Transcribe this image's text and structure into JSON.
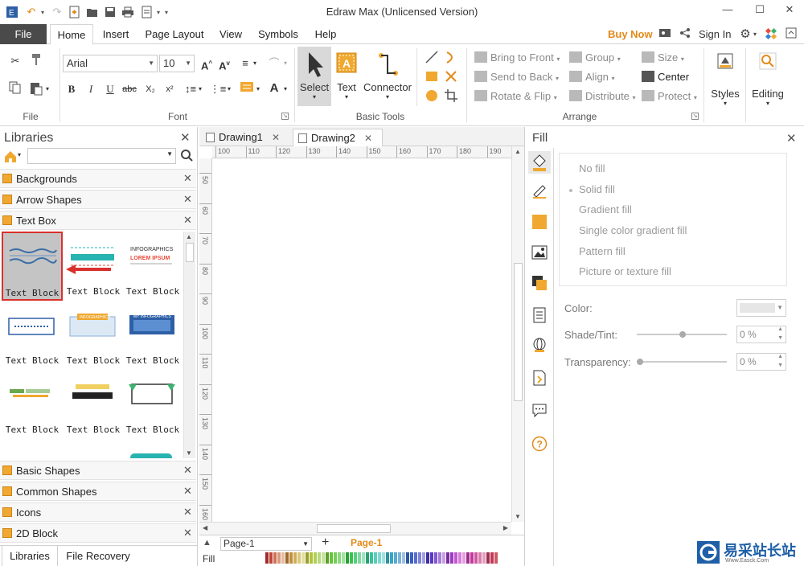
{
  "window": {
    "title": "Edraw Max (Unlicensed Version)"
  },
  "menu": {
    "file": "File",
    "tabs": [
      "Home",
      "Insert",
      "Page Layout",
      "View",
      "Symbols",
      "Help"
    ],
    "buy_now": "Buy Now",
    "sign_in": "Sign In"
  },
  "ribbon": {
    "groups": {
      "file": "File",
      "font": "Font",
      "basic_tools": "Basic Tools",
      "arrange": "Arrange"
    },
    "font": {
      "family": "Arial",
      "size": "10"
    },
    "tools": {
      "select": "Select",
      "text": "Text",
      "connector": "Connector"
    },
    "arrange": {
      "bring_to_front": "Bring to Front",
      "send_to_back": "Send to Back",
      "rotate_flip": "Rotate & Flip",
      "group": "Group",
      "align": "Align",
      "distribute": "Distribute",
      "size": "Size",
      "center": "Center",
      "protect": "Protect"
    },
    "styles": "Styles",
    "editing": "Editing",
    "format_buttons": {
      "bold": "B",
      "italic": "I",
      "underline": "U",
      "strike": "abc",
      "subscript": "X₂",
      "superscript": "x²"
    }
  },
  "libraries": {
    "title": "Libraries",
    "search_placeholder": "",
    "categories_top": [
      "Backgrounds",
      "Arrow Shapes",
      "Text Box"
    ],
    "shape_label": "Text Block",
    "shape_count": 9,
    "thumb_text": {
      "infographics": "INFOGRAPHICS",
      "lorem": "LOREM IPSUM",
      "my_info": "MY INFOGRAPHICS"
    },
    "categories_bottom": [
      "Basic Shapes",
      "Common Shapes",
      "Icons",
      "2D Block"
    ],
    "tabs": [
      "Libraries",
      "File Recovery"
    ]
  },
  "documents": {
    "tabs": [
      "Drawing1",
      "Drawing2"
    ]
  },
  "rulers": {
    "horizontal": [
      "100",
      "110",
      "120",
      "130",
      "140",
      "150",
      "160",
      "170",
      "180",
      "190"
    ],
    "vertical": [
      "50",
      "60",
      "70",
      "80",
      "90",
      "100",
      "110",
      "120",
      "130",
      "140",
      "150",
      "160"
    ]
  },
  "pages": {
    "current": "Page-1",
    "tab": "Page-1",
    "fill_label": "Fill"
  },
  "fill": {
    "title": "Fill",
    "options": [
      "No fill",
      "Solid fill",
      "Gradient fill",
      "Single color gradient fill",
      "Pattern fill",
      "Picture or texture fill"
    ],
    "color_label": "Color:",
    "shade_label": "Shade/Tint:",
    "shade_value": "0 %",
    "transparency_label": "Transparency:",
    "transparency_value": "0 %"
  },
  "watermark": {
    "text": "易采站长站",
    "sub": "Www.Easck.Com"
  },
  "colors": {
    "accent_orange": "#f0a830",
    "selected_red": "#d9302c",
    "file_tab": "#4a4a4a"
  }
}
